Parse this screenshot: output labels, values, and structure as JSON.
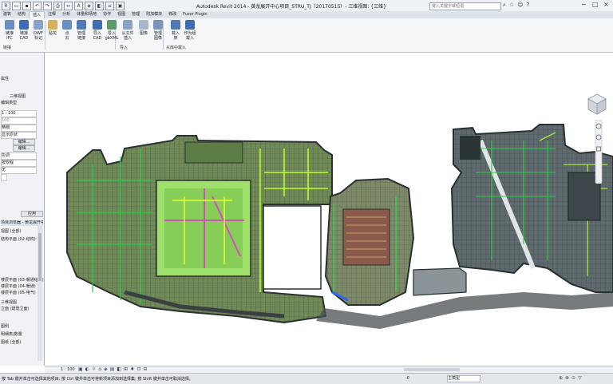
{
  "window": {
    "title": "Autodesk Revit 2014 -   黄龙展开中心项目_STRU_TJ（20170515）- 三维视图: {三维}",
    "search_placeholder": "键入关键字或短语",
    "controls": [
      "−",
      "□",
      "×"
    ]
  },
  "ribbon_tabs": [
    "建筑",
    "结构",
    "插入",
    "注释",
    "分析",
    "体量和场地",
    "协作",
    "视图",
    "管理",
    "附加模块",
    "修改",
    "Fuzor Plugin"
  ],
  "active_tab": "插入",
  "ribbon_buttons": [
    {
      "label": "链接",
      "sub": "IFC",
      "color": "#6a8fc5"
    },
    {
      "label": "链接",
      "sub": "CAD",
      "color": "#3f6db0"
    },
    {
      "label": "DWF",
      "sub": "标记",
      "color": "#8aa2c7"
    },
    {
      "label": "贴花",
      "sub": "",
      "color": "#d7b15a"
    },
    {
      "label": "点",
      "sub": "云",
      "color": "#6a8fc5"
    },
    {
      "label": "管理",
      "sub": "链接",
      "color": "#4f7ab7"
    },
    {
      "label": "导入",
      "sub": "CAD",
      "color": "#3f6db0"
    },
    {
      "label": "导入",
      "sub": "gbXML",
      "color": "#5a9b6a"
    },
    {
      "label": "从文件",
      "sub": "插入",
      "color": "#8aa2c7"
    },
    {
      "label": "图像",
      "sub": "",
      "color": "#a8b7cc"
    },
    {
      "label": "管理",
      "sub": "图像",
      "color": "#7b93b8"
    },
    {
      "label": "载入",
      "sub": "族",
      "color": "#4f7ab7"
    },
    {
      "label": "作为组",
      "sub": "载入",
      "color": "#3f6db0"
    }
  ],
  "panel_labels": [
    "链接",
    "导入",
    "从库中载入"
  ],
  "properties": {
    "title": "属性",
    "type": "三维视图",
    "edit_type_label": "编辑类型",
    "rows": [
      {
        "label": "1 : 100"
      },
      {
        "label": "100"
      },
      {
        "label": "精细"
      },
      {
        "label": "显示原状"
      }
    ],
    "edit_button_1": "编辑...",
    "edit_button_2": "编辑...",
    "rows2": [
      {
        "label": "协调"
      },
      {
        "label": "按规程"
      },
      {
        "label": "无"
      }
    ],
    "apply": "应用"
  },
  "browser": {
    "title": "项目浏览器 - 黄龙展开中心项目...",
    "items": [
      {
        "label": "视图 (全部)"
      },
      {
        "label": "结构平面 (02-结构)"
      },
      {
        "label": "楼层平面 (03-暖通给水)"
      },
      {
        "label": "楼层平面 (04-暖通)"
      },
      {
        "label": "楼层平面 (05-电气)"
      },
      {
        "label": "三维视图"
      },
      {
        "label": "立面 (建筑立面)"
      },
      {
        "label": "图例"
      },
      {
        "label": "明细表/数量"
      },
      {
        "label": "图纸 (全部)"
      }
    ]
  },
  "view_control": {
    "scale": "1 : 100"
  },
  "status": {
    "text": "按 Tab 键并单击可选择其他项目; 按 Ctrl 键并单击可将新项目添加到选择集; 按 Shift 键并单击可取消选择。",
    "view_name": "主模型",
    "zero": ":0"
  },
  "colors": {
    "accent": "#2f6fc1",
    "green": "#1fbf3a",
    "lime": "#b8ff2a",
    "magenta": "#d040c0",
    "dark": "#2c3437"
  }
}
